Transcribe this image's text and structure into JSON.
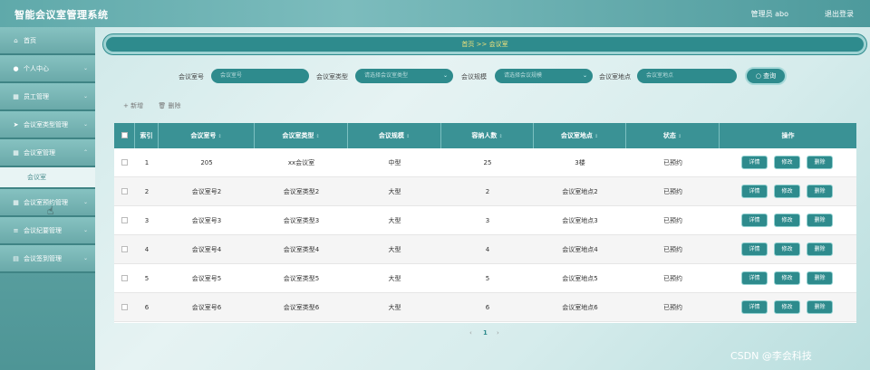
{
  "app": {
    "title": "智能会议室管理系统",
    "user": "管理员 abo",
    "logout": "退出登录"
  },
  "sidebar": {
    "items": [
      {
        "icon": "⌂",
        "label": "首页"
      },
      {
        "icon": "●",
        "label": "个人中心"
      },
      {
        "icon": "▦",
        "label": "员工管理"
      },
      {
        "icon": "➤",
        "label": "会议室类型管理"
      },
      {
        "icon": "▦",
        "label": "会议室管理"
      },
      {
        "icon": "▦",
        "label": "会议室预约管理"
      },
      {
        "icon": "≡",
        "label": "会议纪要管理"
      },
      {
        "icon": "▤",
        "label": "会议签到管理"
      }
    ],
    "submenu": "会议室"
  },
  "breadcrumb": "首页 >> 会议室",
  "search": {
    "fields": [
      {
        "label": "会议室号",
        "placeholder": "会议室号"
      },
      {
        "label": "会议室类型",
        "placeholder": "请选择会议室类型"
      },
      {
        "label": "会议规模",
        "placeholder": "请选择会议规模"
      },
      {
        "label": "会议室地点",
        "placeholder": "会议室地点"
      }
    ],
    "button": "查询",
    "button_icon": "○"
  },
  "toolbar": {
    "add": "+ 新增",
    "delete": "🗑 删除"
  },
  "table": {
    "headers": [
      "索引",
      "会议室号",
      "会议室类型",
      "会议规模",
      "容纳人数",
      "会议室地点",
      "状态",
      "操作"
    ],
    "sort_arrow": "↕",
    "rows": [
      [
        "1",
        "205",
        "xx会议室",
        "中型",
        "25",
        "3楼",
        "已预约"
      ],
      [
        "2",
        "会议室号2",
        "会议室类型2",
        "大型",
        "2",
        "会议室地点2",
        "已预约"
      ],
      [
        "3",
        "会议室号3",
        "会议室类型3",
        "大型",
        "3",
        "会议室地点3",
        "已预约"
      ],
      [
        "4",
        "会议室号4",
        "会议室类型4",
        "大型",
        "4",
        "会议室地点4",
        "已预约"
      ],
      [
        "5",
        "会议室号5",
        "会议室类型5",
        "大型",
        "5",
        "会议室地点5",
        "已预约"
      ],
      [
        "6",
        "会议室号6",
        "会议室类型6",
        "大型",
        "6",
        "会议室地点6",
        "已预约"
      ]
    ],
    "actions": [
      "详情",
      "修改",
      "删除"
    ]
  },
  "pagination": {
    "prev": "‹",
    "page": "1",
    "next": "›"
  },
  "watermark": "CSDN @李会科技"
}
